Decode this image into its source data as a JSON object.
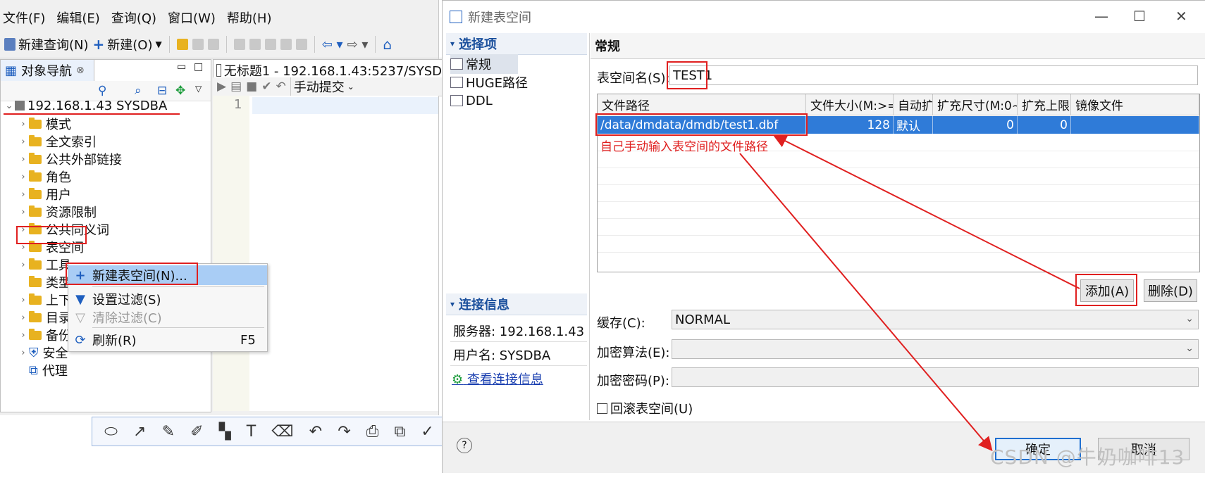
{
  "left_app": {
    "menu": [
      "文件(F)",
      "编辑(E)",
      "查询(Q)",
      "窗口(W)",
      "帮助(H)"
    ],
    "toolbar": {
      "new_query": "新建查询(N)",
      "new": "新建(O)"
    },
    "nav_tab": "对象导航",
    "tree": {
      "root": "192.168.1.43  SYSDBA",
      "items": [
        "模式",
        "全文索引",
        "公共外部链接",
        "角色",
        "用户",
        "资源限制",
        "公共同义词",
        "表空间",
        "工具",
        "类型",
        "上下",
        "目录",
        "备份",
        "安全",
        "代理"
      ]
    },
    "editor_tab": "无标题1 - 192.168.1.43:5237/SYSD",
    "commit_mode": "手动提交",
    "line_number": "1",
    "context_menu": [
      {
        "label": "新建表空间(N)...",
        "shortcut": ""
      },
      {
        "label": "设置过滤(S)",
        "shortcut": ""
      },
      {
        "label": "清除过滤(C)",
        "shortcut": ""
      },
      {
        "label": "刷新(R)",
        "shortcut": "F5"
      }
    ]
  },
  "dialog": {
    "title": "新建表空间",
    "sections": {
      "select_title": "选择项",
      "select_items": [
        "常规",
        "HUGE路径",
        "DDL"
      ],
      "conn_title": "连接信息",
      "server": "服务器: 192.168.1.43",
      "user": "用户名: SYSDBA",
      "view_conn": "查看连接信息"
    },
    "header": "常规",
    "tablespace_label": "表空间名(S):",
    "tablespace_value": "TEST1",
    "table": {
      "headers": [
        "文件路径",
        "文件大小(M:>=",
        "自动扩",
        "扩充尺寸(M:0~",
        "扩充上限",
        "镜像文件"
      ],
      "rows": [
        [
          "/data/dmdata/dmdb/test1.dbf",
          "128",
          "默认",
          "0",
          "0",
          ""
        ]
      ]
    },
    "annotation": "自己手动输入表空间的文件路径",
    "add_button": "添加(A)",
    "delete_button": "删除(D)",
    "cache_label": "缓存(C):",
    "cache_value": "NORMAL",
    "encrypt_algo_label": "加密算法(E):",
    "encrypt_pwd_label": "加密密码(P):",
    "rollback_label": "回滚表空间(U)",
    "ok_button": "确定",
    "cancel_button": "取消",
    "help_icon": "?"
  },
  "watermark": "CSDN @牛奶咖啡13",
  "colors": {
    "accent": "#2f7bd8",
    "annotation": "#e02020"
  }
}
